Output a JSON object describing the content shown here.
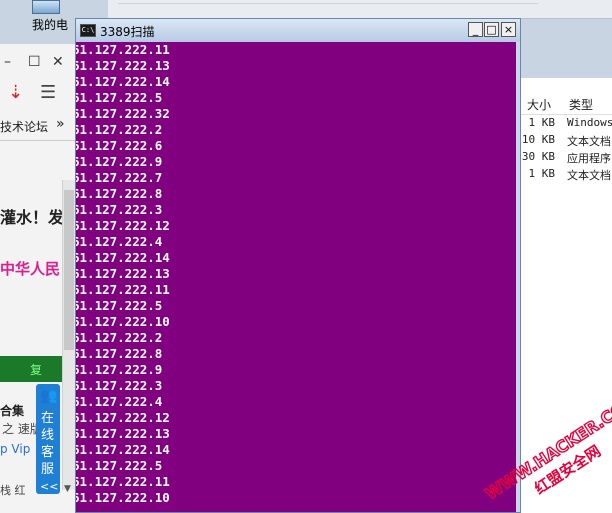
{
  "desktop": {
    "icon_label": "我的电"
  },
  "browser": {
    "btn_min": "–",
    "btn_max": "☐",
    "btn_close": "✕",
    "btn_download": "⇣",
    "btn_menu": "☰",
    "bookmark": "技术论坛",
    "bookmark_more": "»",
    "headline_1": "灌水！发",
    "headline_2": "中华人民",
    "green_banner": "复",
    "sub_1": "合集",
    "sub_2": "之 速版",
    "sub_3": "p  Vip",
    "sub_4": "栈  红"
  },
  "chat": {
    "text": "在线客服",
    "arrow": "<<"
  },
  "explorer": {
    "headers": {
      "size": "大小",
      "type": "类型"
    },
    "rows": [
      {
        "size": "1 KB",
        "type": "Windows"
      },
      {
        "size": "10 KB",
        "type": "文本文档"
      },
      {
        "size": "30 KB",
        "type": "应用程序"
      },
      {
        "size": "1 KB",
        "type": "文本文档"
      }
    ]
  },
  "cmd": {
    "title": "3389扫描",
    "icon_text": "C:\\",
    "btn_min": "_",
    "btn_max": "□",
    "btn_close": "×",
    "background": "#800080",
    "lines": [
      "61.127.222.11",
      "61.127.222.13",
      "61.127.222.14",
      "61.127.222.5",
      "61.127.222.32",
      "61.127.222.2",
      "61.127.222.6",
      "61.127.222.9",
      "61.127.222.7",
      "61.127.222.8",
      "61.127.222.3",
      "61.127.222.12",
      "61.127.222.4",
      "61.127.222.14",
      "61.127.222.13",
      "61.127.222.11",
      "61.127.222.5",
      "61.127.222.10",
      "61.127.222.2",
      "61.127.222.8",
      "61.127.222.9",
      "61.127.222.3",
      "61.127.222.4",
      "61.127.222.12",
      "61.127.222.13",
      "61.127.222.14",
      "61.127.222.5",
      "61.127.222.11",
      "61.127.222.10"
    ]
  },
  "watermark": {
    "line1": "WWW.HACKER.COM",
    "line2": "红盟安全网",
    "color": "#e8003a"
  }
}
